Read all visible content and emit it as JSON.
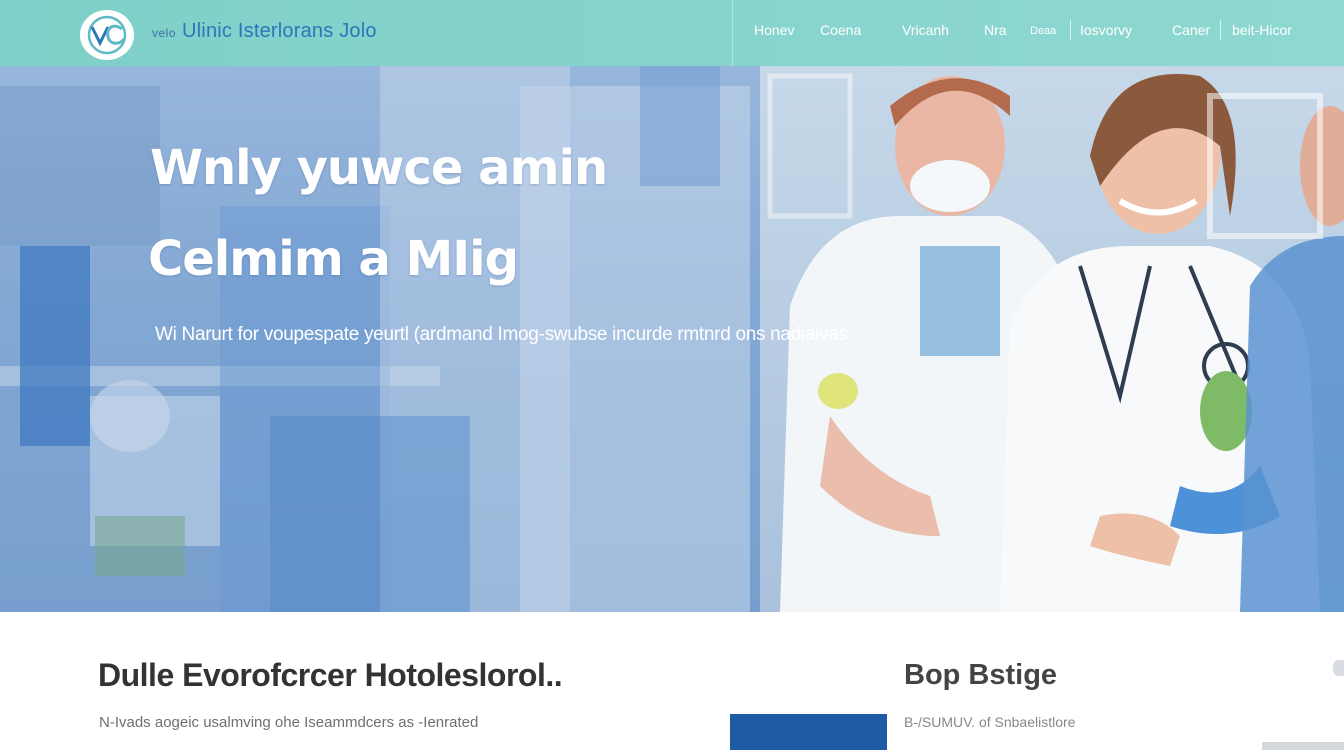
{
  "header": {
    "brand_small": "velo",
    "brand_name": "Ulinic Isterlorans Jolo",
    "nav": [
      "Honev",
      "Coena",
      "Vricanh",
      "Nra",
      "Deaa",
      "Iosvorvy",
      "Caner",
      "beit-Hicor"
    ]
  },
  "hero": {
    "title_line1": "Wnly yuwce amin",
    "title_line2": "Celmim a  MIig",
    "subtitle": "Wi  Narurt for voupespate yeurtl  (ardmand  Imog-swubse incurde rmtnrd  ons nadiaivas"
  },
  "section": {
    "title": "Dulle  Evorofcrcer Hotoleslorol..",
    "text": "N-Ivads aogeic usalmving ohe Iseammdcers  as -Ienrated"
  },
  "sidebar_box": {
    "title": "Bop Bstige",
    "text": "B-/SUMUV. of Snbaelistlore"
  },
  "colors": {
    "header_bg": "#86d3cd",
    "brand_blue": "#2c77b8",
    "accent_blue": "#1f5aa7"
  }
}
